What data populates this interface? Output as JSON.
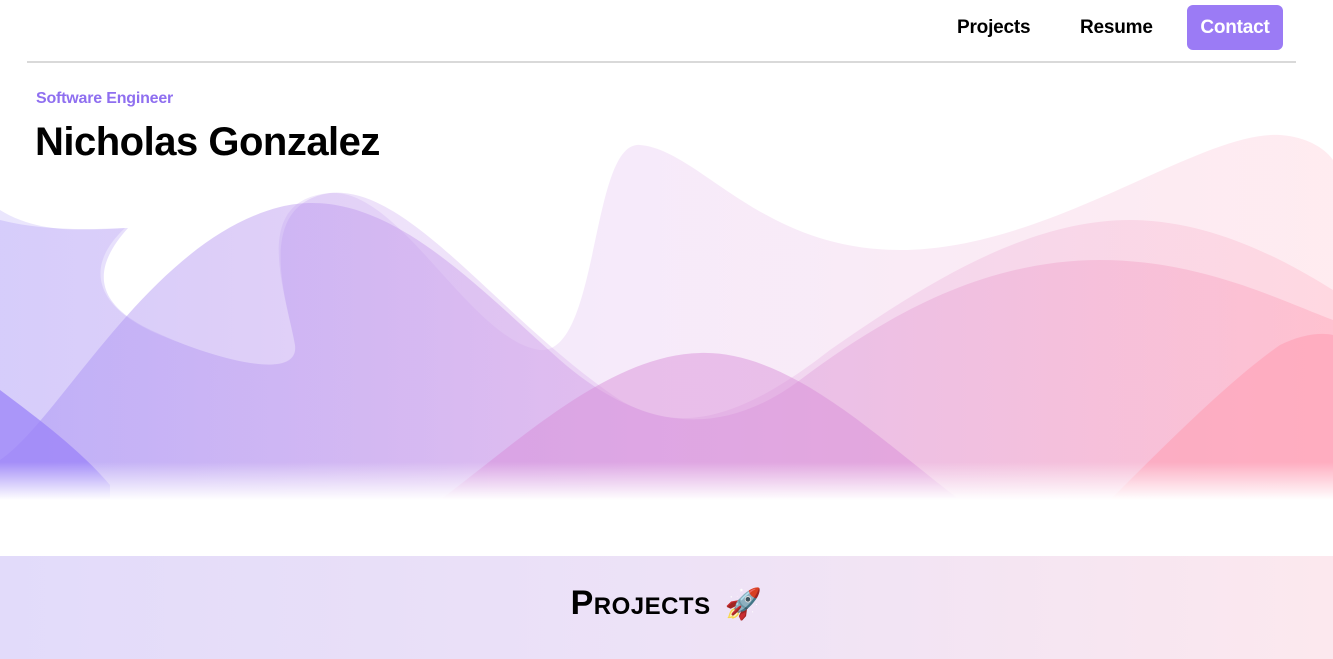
{
  "nav": {
    "links": [
      {
        "label": "Projects"
      },
      {
        "label": "Resume"
      }
    ],
    "contact_label": "Contact"
  },
  "hero": {
    "subtitle": "Software Engineer",
    "name": "Nicholas Gonzalez"
  },
  "projects": {
    "heading": "Projects",
    "emoji": "🚀"
  },
  "colors": {
    "accent": "#9b7bf5",
    "wave_start": "#9d86f7",
    "wave_end": "#ffa3b9"
  }
}
